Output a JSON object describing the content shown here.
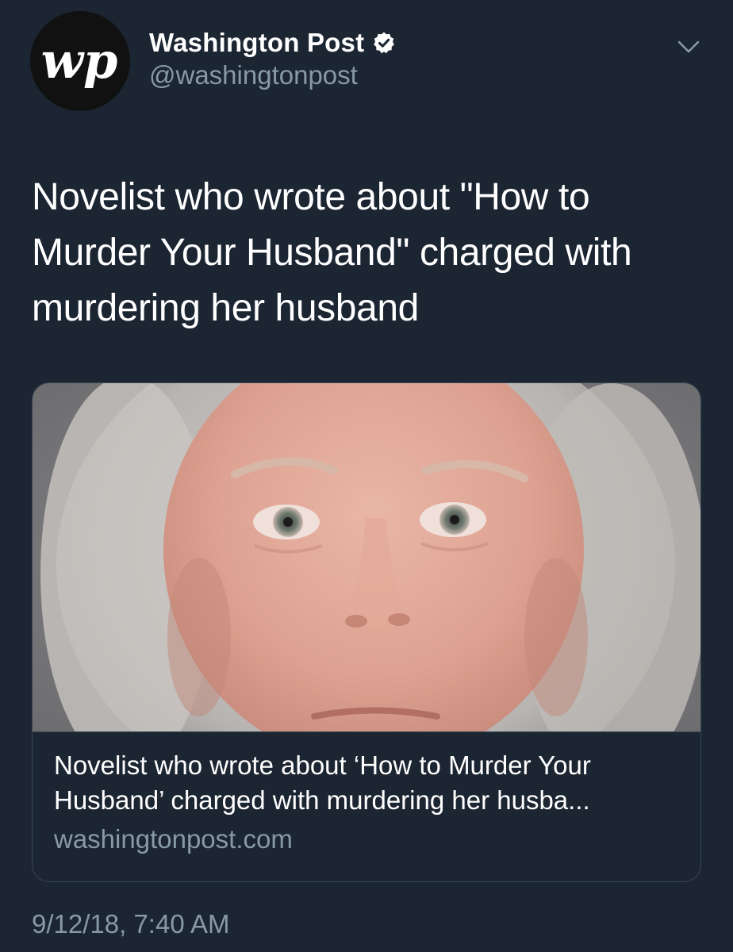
{
  "author": {
    "display_name": "Washington Post",
    "handle": "@washingtonpost",
    "avatar_logo_text": "wp",
    "verified": true
  },
  "tweet": {
    "text_lines": [
      "Novelist who wrote about \"How to",
      "Murder Your Husband\" charged with",
      "murdering her husband"
    ],
    "timestamp": "9/12/18, 7:40 AM"
  },
  "card": {
    "title_lines": [
      "Novelist who wrote about ‘How to Murder Your",
      "Husband’ charged with murdering her husba..."
    ],
    "domain": "washingtonpost.com",
    "image_alt": "mugshot-photo"
  },
  "icons": {
    "verified": "verified-badge-icon",
    "menu": "chevron-down-icon"
  },
  "colors": {
    "background": "#1c2532",
    "secondary_text": "#8899a6",
    "card_border": "#3a4654",
    "verified_badge": "#ffffff"
  }
}
